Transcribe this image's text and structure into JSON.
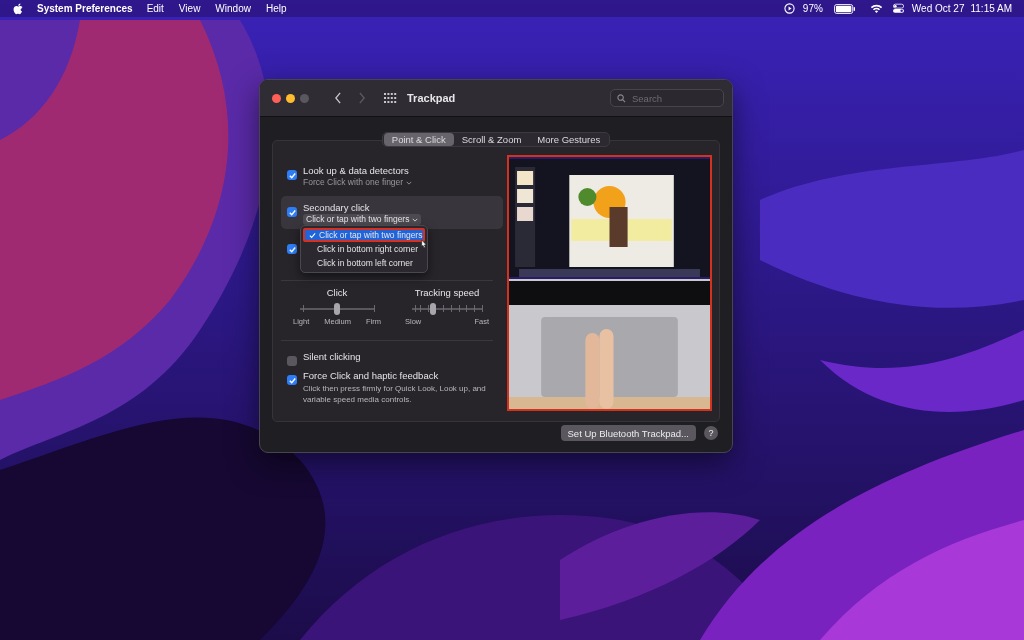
{
  "menu_bar": {
    "app_name": "System Preferences",
    "menus": [
      "Edit",
      "View",
      "Window",
      "Help"
    ],
    "battery": "97%",
    "date": "Wed Oct 27",
    "time": "11:15 AM"
  },
  "window": {
    "title": "Trackpad",
    "search": {
      "placeholder": "Search"
    },
    "tabs": [
      {
        "label": "Point & Click",
        "selected": true
      },
      {
        "label": "Scroll & Zoom",
        "selected": false
      },
      {
        "label": "More Gestures",
        "selected": false
      }
    ],
    "options": [
      {
        "label": "Look up & data detectors",
        "checked": true,
        "popup": "Force Click with one finger"
      },
      {
        "label": "Secondary click",
        "checked": true,
        "highlighted": true,
        "popup": "Click or tap with two fingers",
        "open_menu": [
          {
            "label": "Click or tap with two fingers",
            "selected": true
          },
          {
            "label": "Click in bottom right corner",
            "selected": false
          },
          {
            "label": "Click in bottom left corner",
            "selected": false
          }
        ]
      },
      {
        "checked": true
      }
    ],
    "sliders": [
      {
        "title": "Click",
        "kind": "coarse",
        "level": 0.5,
        "tick_labels": [
          "Light",
          "Medium",
          "Firm"
        ]
      },
      {
        "title": "Tracking speed",
        "kind": "fine",
        "level": 0.3,
        "tick_labels": [
          "Slow",
          "Fast"
        ]
      }
    ],
    "bottom_options": [
      {
        "label": "Silent clicking",
        "checked": false
      },
      {
        "label": "Force Click and haptic feedback",
        "checked": true,
        "description": "Click then press firmly for Quick Look, Look up, and variable speed media controls."
      }
    ],
    "setup_button": "Set Up Bluetooth Trackpad...",
    "help_button": "?"
  }
}
